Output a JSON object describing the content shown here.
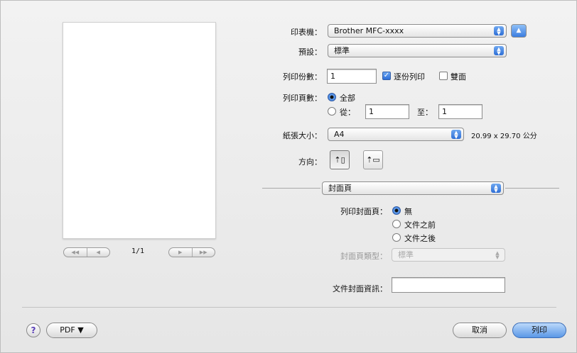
{
  "preview": {
    "page_counter": "1/1",
    "nav_first": "◀◀",
    "nav_prev": "◀",
    "nav_next": "▶",
    "nav_last": "▶▶"
  },
  "printer": {
    "label": "印表機：",
    "value": "Brother MFC-xxxx",
    "expand_icon": "▲"
  },
  "presets": {
    "label": "預設：",
    "value": "標準"
  },
  "copies": {
    "label": "列印份數：",
    "value": "1",
    "collated_label": "逐份列印",
    "collated_checked": true,
    "two_sided_label": "雙面",
    "two_sided_checked": false
  },
  "pages": {
    "label": "列印頁數：",
    "all_label": "全部",
    "from_label": "從：",
    "from_value": "1",
    "to_label": "至：",
    "to_value": "1",
    "selected": "all"
  },
  "paper_size": {
    "label": "紙張大小：",
    "value": "A4",
    "dimensions": "20.99 x 29.70 公分"
  },
  "orientation": {
    "label": "方向：",
    "portrait_icon": "portrait-icon",
    "landscape_icon": "landscape-icon",
    "selected": "portrait"
  },
  "section": {
    "value": "封面頁"
  },
  "cover_page": {
    "label": "列印封面頁：",
    "options": [
      "無",
      "文件之前",
      "文件之後"
    ],
    "selected": 0,
    "type_label": "封面頁類型：",
    "type_value": "標準",
    "info_label": "文件封面資訊：",
    "info_value": ""
  },
  "footer": {
    "help_label": "?",
    "pdf_label": "PDF ▼",
    "cancel_label": "取消",
    "print_label": "列印"
  },
  "colors": {
    "accent": "#2f6fd6",
    "background": "#ebebeb"
  }
}
